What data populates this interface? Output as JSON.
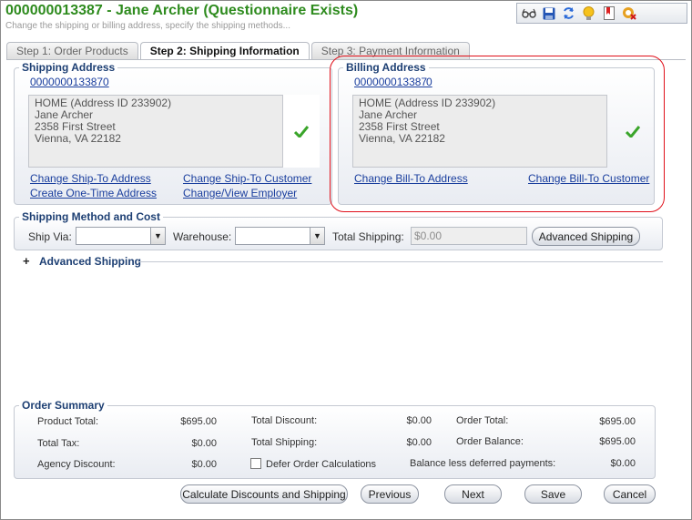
{
  "header": {
    "title": "000000013387 - Jane Archer (Questionnaire Exists)",
    "subtitle": "Change the shipping or billing address, specify the shipping methods..."
  },
  "toolbar": {
    "icons": [
      "glasses-icon",
      "save-icon",
      "refresh-icon",
      "lightbulb-icon",
      "bookmark-icon",
      "close-record-icon"
    ]
  },
  "tabs": [
    {
      "label": "Step 1: Order Products",
      "active": false
    },
    {
      "label": "Step 2: Shipping Information",
      "active": true
    },
    {
      "label": "Step 3: Payment Information",
      "active": false
    }
  ],
  "shipping_address": {
    "legend": "Shipping Address",
    "customer_id": "000000013387",
    "customer_sub": "0",
    "address_lines": [
      "HOME (Address ID 233902)",
      "Jane Archer",
      "2358 First Street",
      "Vienna, VA 22182"
    ],
    "links": {
      "change_ship_to_address": "Change Ship-To Address",
      "change_ship_to_customer": "Change Ship-To Customer",
      "create_one_time_address": "Create One-Time Address",
      "change_view_employer": "Change/View Employer"
    }
  },
  "billing_address": {
    "legend": "Billing Address",
    "customer_id": "000000013387",
    "customer_sub": "0",
    "address_lines": [
      "HOME (Address ID 233902)",
      "Jane Archer",
      "2358 First Street",
      "Vienna, VA 22182"
    ],
    "links": {
      "change_bill_to_address": "Change Bill-To Address",
      "change_bill_to_customer": "Change Bill-To Customer"
    }
  },
  "shipping_method": {
    "legend": "Shipping Method and Cost",
    "ship_via_label": "Ship Via:",
    "ship_via_value": "",
    "warehouse_label": "Warehouse:",
    "warehouse_value": "",
    "total_shipping_label": "Total Shipping:",
    "total_shipping_value": "$0.00",
    "advanced_shipping_button": "Advanced Shipping"
  },
  "advanced_shipping_section": {
    "toggle": "+",
    "label": "Advanced Shipping"
  },
  "order_summary": {
    "legend": "Order Summary",
    "product_total_label": "Product Total:",
    "product_total": "$695.00",
    "total_tax_label": "Total Tax:",
    "total_tax": "$0.00",
    "agency_discount_label": "Agency Discount:",
    "agency_discount": "$0.00",
    "total_discount_label": "Total Discount:",
    "total_discount": "$0.00",
    "total_shipping_label": "Total Shipping:",
    "total_shipping": "$0.00",
    "defer_label": "Defer Order Calculations",
    "defer_checked": false,
    "order_total_label": "Order Total:",
    "order_total": "$695.00",
    "order_balance_label": "Order Balance:",
    "order_balance": "$695.00",
    "balance_less_deferred_label": "Balance less deferred payments:",
    "balance_less_deferred": "$0.00"
  },
  "buttons": {
    "calculate": "Calculate Discounts and Shipping",
    "previous": "Previous",
    "next": "Next",
    "save": "Save",
    "cancel": "Cancel"
  },
  "colors": {
    "title_green": "#2e8b1e",
    "link_blue": "#1a3e9e",
    "legend_navy": "#1d3f73",
    "highlight_red": "#e0101a",
    "check_green": "#3aa52a"
  }
}
